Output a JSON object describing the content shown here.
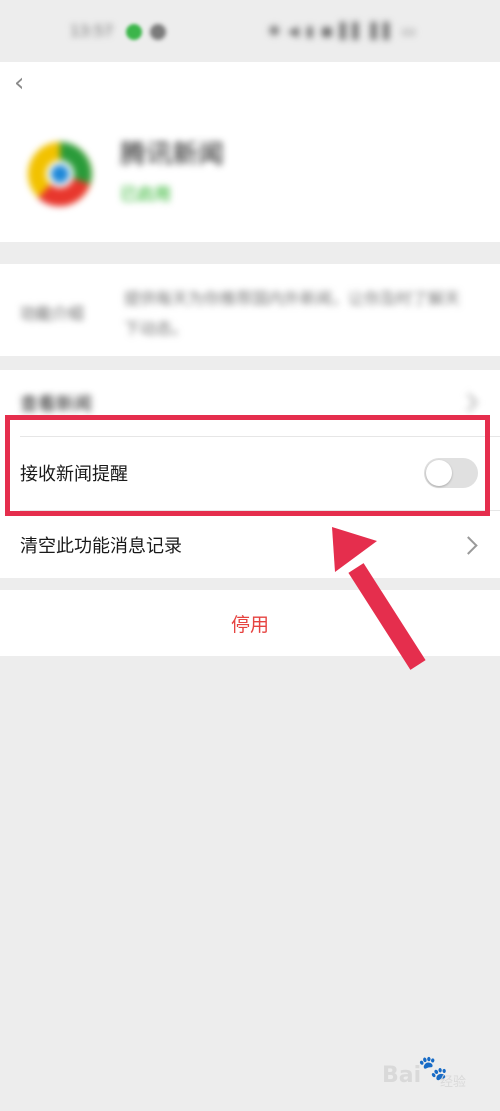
{
  "status_bar": {
    "time": "13:57",
    "icons": "✱ ◀ ▮ ◼ ▌▌ ▌▌ ▭"
  },
  "header": {
    "app_name": "腾讯新闻",
    "app_status": "已启用"
  },
  "intro": {
    "label": "功能介绍",
    "text": "提供每天为你推荐国内外新闻，让你及时了解天下动态。"
  },
  "settings": {
    "row_view_news": "查看新闻",
    "row_receive_alerts": "接收新闻提醒",
    "receive_alerts_on": false,
    "row_clear_history": "清空此功能消息记录"
  },
  "actions": {
    "disable_label": "停用"
  },
  "annotation_color": "#e52e4d",
  "accent_green": "#1aad19",
  "danger_red": "#e64340",
  "watermark": {
    "text": "Bai",
    "paw": "🐾",
    "suffix": "经验"
  }
}
